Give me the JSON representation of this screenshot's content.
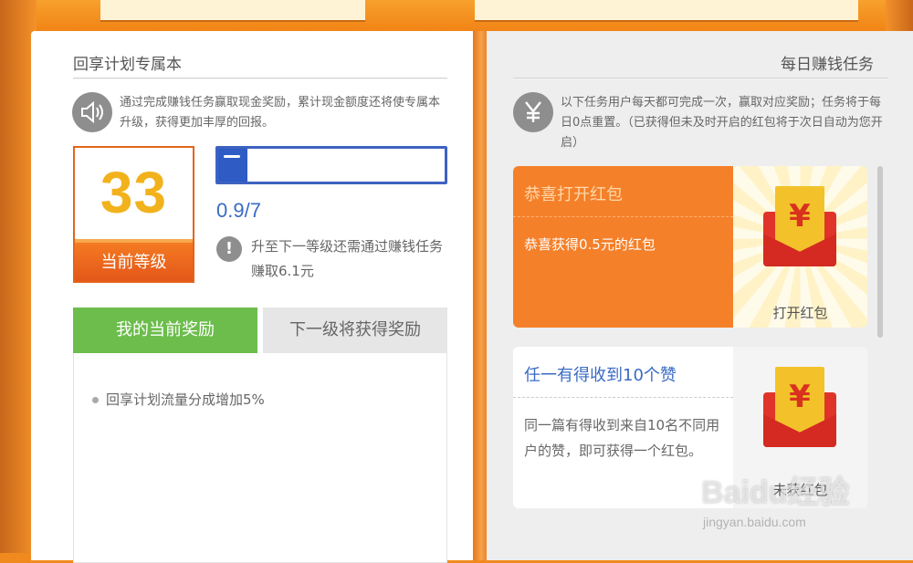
{
  "left_page": {
    "title": "回享计划专属本",
    "notice": "通过完成赚钱任务赢取现金奖励，累计现金额度还将使专属本升级，获得更加丰厚的回报。",
    "level": {
      "value": "33",
      "label": "当前等级"
    },
    "progress": {
      "fraction": 0.13,
      "text": "0.9/7"
    },
    "upgrade_hint": "升至下一等级还需通过赚钱任务赚取6.1元",
    "tabs": [
      {
        "label": "我的当前奖励"
      },
      {
        "label": "下一级将获得奖励"
      }
    ],
    "rewards": [
      "回享计划流量分成增加5%"
    ]
  },
  "right_page": {
    "title": "每日赚钱任务",
    "notice": "以下任务用户每天都可完成一次，赢取对应奖励；任务将于每日0点重置。（已获得但未及时开启的红包将于次日自动为您开启）",
    "tasks": [
      {
        "title": "恭喜打开红包",
        "subtitle": "恭喜获得0.5元的红包",
        "action": "打开红包"
      },
      {
        "title": "任一有得收到10个赞",
        "subtitle": "同一篇有得收到来自10名不同用户的赞，即可获得一个红包。",
        "action": "未获红包"
      }
    ]
  },
  "icons": {
    "sound": "speaker-icon",
    "yen": "yen-icon",
    "info": "exclamation-icon",
    "envelope_symbol": "¥"
  },
  "watermark": {
    "text": "Baidu经验",
    "url": "jingyan.baidu.com"
  },
  "colors": {
    "orange": "#f5802a",
    "green": "#6cbd4c",
    "blue": "#3d62c1",
    "red": "#e0342a",
    "gold": "#f2b21c"
  }
}
